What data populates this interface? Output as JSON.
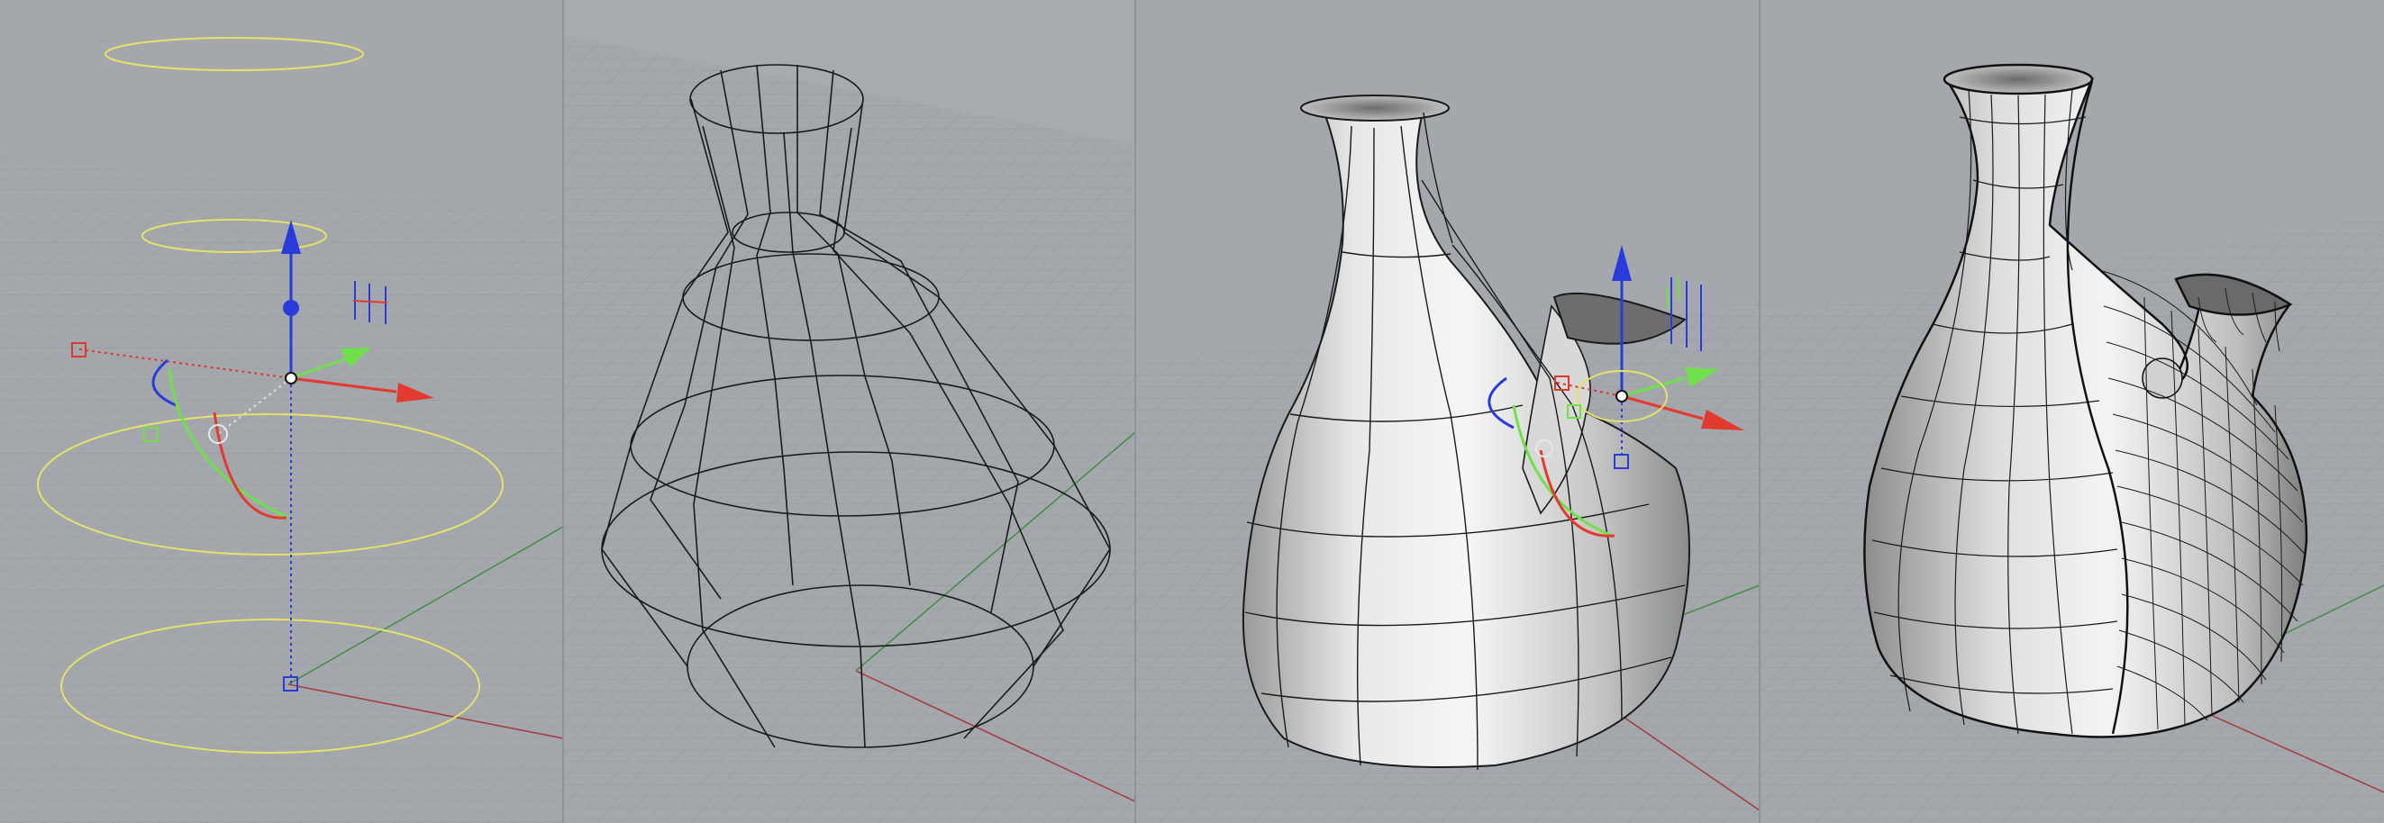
{
  "scene": {
    "description_visible_text": "",
    "viewports": [
      {
        "id": "vp1",
        "content": "profile-curves-with-gumball"
      },
      {
        "id": "vp2",
        "content": "wireframe-vase-mesh"
      },
      {
        "id": "vp3",
        "content": "shaded-vase-with-spout-and-gumball"
      },
      {
        "id": "vp4",
        "content": "shaded-vase-dense-isocurves"
      }
    ]
  },
  "colors": {
    "background": "#a3a7ac",
    "grid": "#9499a0",
    "grid_major": "#8a8f96",
    "axis_x": "#c03030",
    "axis_y": "#3a9a3a",
    "curve_yellow": "#e4e26a",
    "gumball_x": "#e23a2e",
    "gumball_y": "#6fe04a",
    "gumball_z": "#2a3bdc",
    "surface_light": "#f2f2f2",
    "surface_mid": "#cfcfcf",
    "surface_dark": "#8a8a8a",
    "wire": "#1a1a1a"
  },
  "icons": [
    "gumball-widget",
    "move-arrow-x",
    "move-arrow-y",
    "move-arrow-z",
    "scale-handle",
    "rotate-arc",
    "plane-handle"
  ]
}
